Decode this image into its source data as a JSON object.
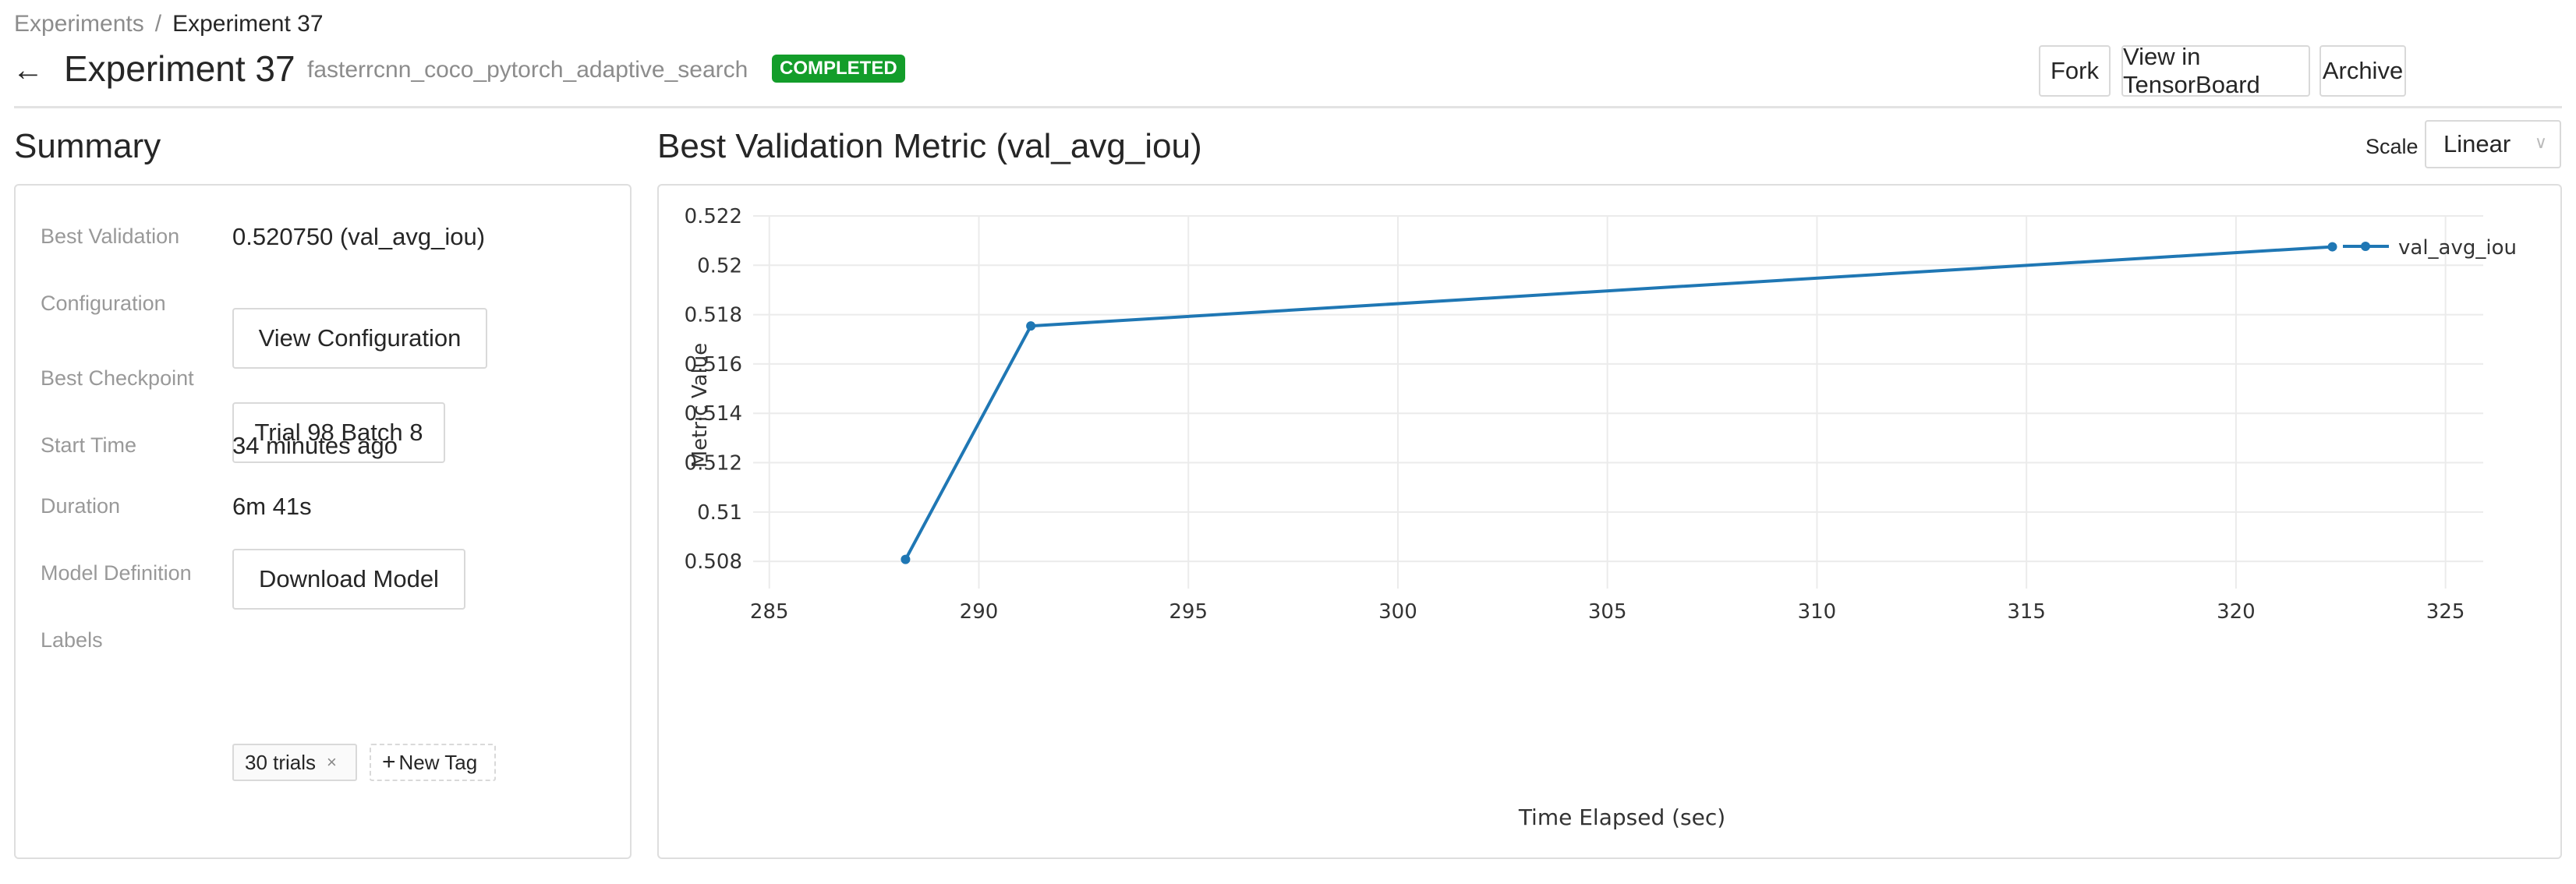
{
  "breadcrumb": {
    "parent": "Experiments",
    "separator": "/",
    "current": "Experiment 37"
  },
  "header": {
    "title": "Experiment 37",
    "subtitle": "fasterrcnn_coco_pytorch_adaptive_search",
    "status": "COMPLETED",
    "status_color": "#139d2a",
    "actions": {
      "fork": "Fork",
      "tensorboard": "View in TensorBoard",
      "archive": "Archive"
    }
  },
  "summary": {
    "heading": "Summary",
    "rows": {
      "best_validation": {
        "label": "Best Validation",
        "value": "0.520750 (val_avg_iou)"
      },
      "configuration": {
        "label": "Configuration",
        "button": "View Configuration"
      },
      "best_checkpoint": {
        "label": "Best Checkpoint",
        "button": "Trial 98 Batch 8"
      },
      "start_time": {
        "label": "Start Time",
        "value": "34 minutes ago"
      },
      "duration": {
        "label": "Duration",
        "value": "6m 41s"
      },
      "model_definition": {
        "label": "Model Definition",
        "button": "Download Model"
      },
      "labels": {
        "label": "Labels",
        "tags": [
          "30 trials"
        ],
        "new_tag": "New Tag"
      }
    }
  },
  "chart_panel": {
    "heading": "Best Validation Metric (val_avg_iou)",
    "scale_label": "Scale",
    "scale_value": "Linear"
  },
  "chart_data": {
    "type": "line",
    "xlabel": "Time Elapsed (sec)",
    "ylabel": "Metric Value",
    "xlim": [
      284.8,
      325.9
    ],
    "ylim": [
      0.5069,
      0.522
    ],
    "xticks": [
      285,
      290,
      295,
      300,
      305,
      310,
      315,
      320,
      325
    ],
    "yticks": [
      0.508,
      0.51,
      0.512,
      0.514,
      0.516,
      0.518,
      0.52,
      0.522
    ],
    "ytick_labels": [
      "0.508",
      "0.51",
      "0.512",
      "0.514",
      "0.516",
      "0.518",
      "0.52",
      "0.522"
    ],
    "grid": true,
    "legend": "top-right",
    "series": [
      {
        "name": "val_avg_iou",
        "color": "#1f77b4",
        "x": [
          288.25,
          291.24,
          322.3
        ],
        "y": [
          0.50808,
          0.51754,
          0.52075
        ]
      }
    ]
  }
}
